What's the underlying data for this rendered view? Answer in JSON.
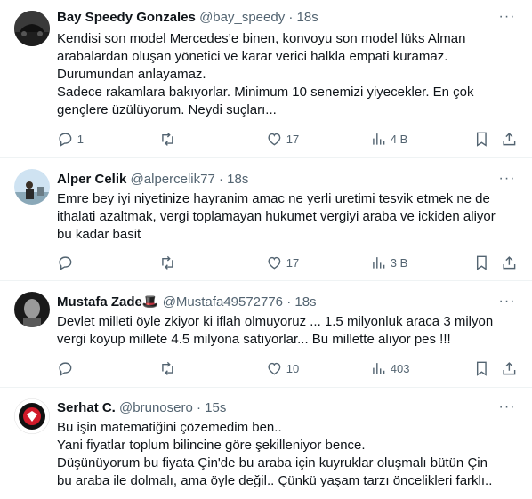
{
  "tweets": [
    {
      "name": "Bay Speedy Gonzales",
      "handle": "@bay_speedy",
      "time": "18s",
      "lines": [
        "Kendisi son model Mercedes’e binen, konvoyu son model lüks Alman",
        "arabalardan oluşan yönetici ve karar verici halkla empati kuramaz.",
        "Durumundan anlayamaz.",
        "Sadece rakamlara bakıyorlar. Minimum 10 senemizi yiyecekler. En çok",
        "gençlere üzülüyorum. Neydi suçları..."
      ],
      "replies": "1",
      "retweets": "",
      "likes": "17",
      "views": "4 B"
    },
    {
      "name": "Alper Celik",
      "handle": "@alpercelik77",
      "time": "18s",
      "lines": [
        "Emre bey iyi niyetinize hayranim amac ne yerli uretimi tesvik etmek ne de",
        "ithalati azaltmak, vergi toplamayan hukumet vergiyi araba ve ickiden aliyor",
        "bu kadar basit"
      ],
      "replies": "",
      "retweets": "",
      "likes": "17",
      "views": "3 B"
    },
    {
      "name": "Mustafa Zade🎩",
      "handle": "@Mustafa49572776",
      "time": "18s",
      "lines": [
        "Devlet milleti öyle zkiyor ki iflah olmuyoruz ... 1.5 milyonluk araca 3 milyon",
        "vergi koyup millete 4.5  milyona satıyorlar... Bu millette alıyor pes !!!"
      ],
      "replies": "",
      "retweets": "",
      "likes": "10",
      "views": "403"
    },
    {
      "name": "Serhat C.",
      "handle": "@brunosero",
      "time": "15s",
      "lines": [
        "Bu işin matematiğini çözemedim ben..",
        "Yani fiyatlar toplum bilincine göre şekilleniyor bence.",
        "Düşünüyorum bu fiyata Çin'de bu araba için kuyruklar oluşmalı bütün Çin",
        "bu araba ile dolmalı, ama öyle değil.. Çünkü yaşam tarzı öncelikleri farklı.."
      ]
    }
  ],
  "separator": "·",
  "more_label": "···",
  "colors": {
    "text": "#0f1419",
    "secondary": "#536471",
    "divider": "#eff3f4"
  }
}
